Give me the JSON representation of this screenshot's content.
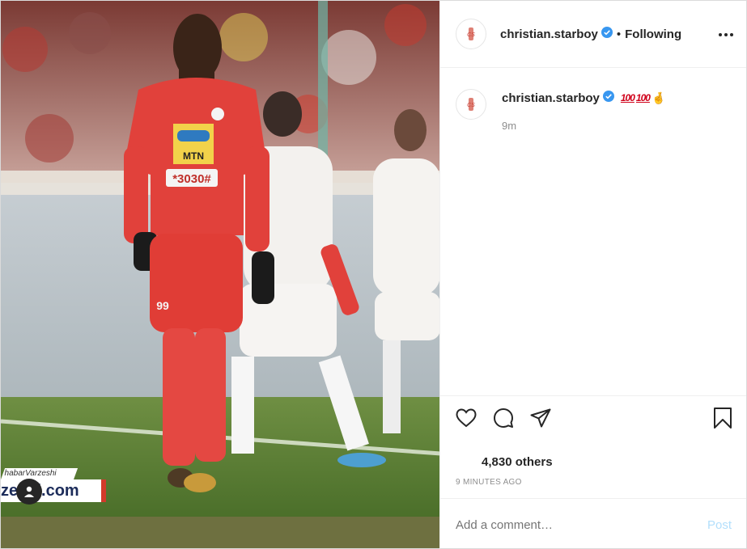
{
  "post": {
    "username": "christian.starboy",
    "follow_separator": "•",
    "follow_status": "Following",
    "caption_username": "christian.starboy",
    "caption_emojis": [
      "100",
      "100",
      "🤞"
    ],
    "caption_time": "9m",
    "likes_text": "4,830 others",
    "posted_ago": "9 MINUTES AGO",
    "comment_placeholder": "Add a comment…",
    "post_label": "Post"
  },
  "media": {
    "watermark_top": "habarVarzeshi",
    "watermark_main": "zeshi.com",
    "jersey_sponsor": "MTN",
    "jersey_code": "*3030#",
    "player_number": "99"
  },
  "icons": {
    "verified": "verified-badge-icon",
    "more": "more-options-icon",
    "like": "heart-icon",
    "comment": "comment-bubble-icon",
    "share": "paper-plane-icon",
    "save": "bookmark-icon",
    "user_tag": "user-tag-icon"
  },
  "colors": {
    "verified_blue": "#3897f0",
    "post_disabled": "#b2dffc",
    "kit_red": "#e1413b",
    "pitch_green": "#4f7a2c"
  }
}
